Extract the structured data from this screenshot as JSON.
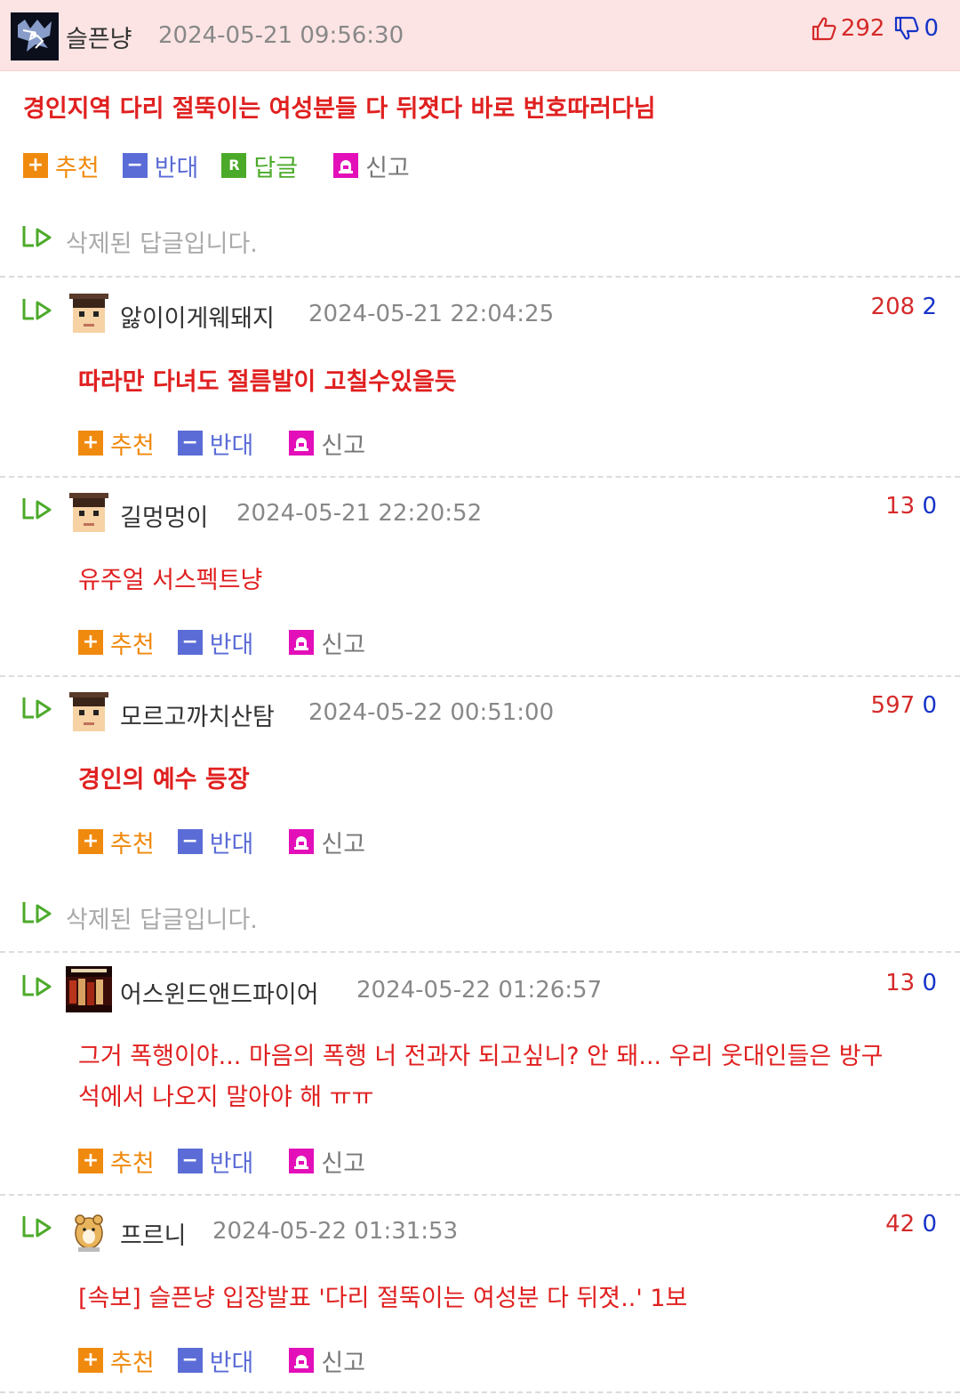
{
  "main": {
    "author": "슬픈냥",
    "date": "2024-05-21 09:56:30",
    "up": "292",
    "down": "0",
    "text": "경인지역 다리 절뚝이는 여성분들 다 뒤졋다 바로 번호따러다님",
    "actions": {
      "recommend": "추천",
      "oppose": "반대",
      "reply": "답글",
      "report": "신고"
    },
    "icons": {
      "up": "thumbs-up-icon",
      "down": "thumbs-down-icon"
    }
  },
  "common": {
    "deleted_text": "삭제된 답글입니다.",
    "recommend": "추천",
    "oppose": "반대",
    "report": "신고"
  },
  "replies": [
    {
      "author": "앓이이게웨돼지",
      "date": "2024-05-21 22:04:25",
      "up": "208",
      "down": "2",
      "text": "따라만 다녀도 절름발이 고칠수있을듯"
    },
    {
      "author": "길멍멍이",
      "date": "2024-05-21 22:20:52",
      "up": "13",
      "down": "0",
      "text": "유주얼 서스펙트냥"
    },
    {
      "author": "모르고까치산탐",
      "date": "2024-05-22 00:51:00",
      "up": "597",
      "down": "0",
      "text": "경인의 예수 등장"
    },
    {
      "author": "어스윈드앤드파이어",
      "date": "2024-05-22 01:26:57",
      "up": "13",
      "down": "0",
      "text1": "그거 폭행이야... 마음의 폭행 너 전과자 되고싶니? 안 돼... 우리 웃대인들은 방구",
      "text2": "석에서 나오지 말아야 해 ㅠㅠ"
    },
    {
      "author": "프르니",
      "date": "2024-05-22 01:31:53",
      "up": "42",
      "down": "0",
      "text": "[속보] 슬픈냥 입장발표 '다리 절뚝이는 여성분 다 뒤졋..' 1보"
    }
  ],
  "colors": {
    "header_bg": "#fce4e4",
    "red": "#e02020",
    "blue": "#1633c8",
    "orange": "#f08a0e",
    "purple_blue": "#5b6cd6",
    "green": "#4caa2a",
    "magenta": "#e30fb8"
  }
}
